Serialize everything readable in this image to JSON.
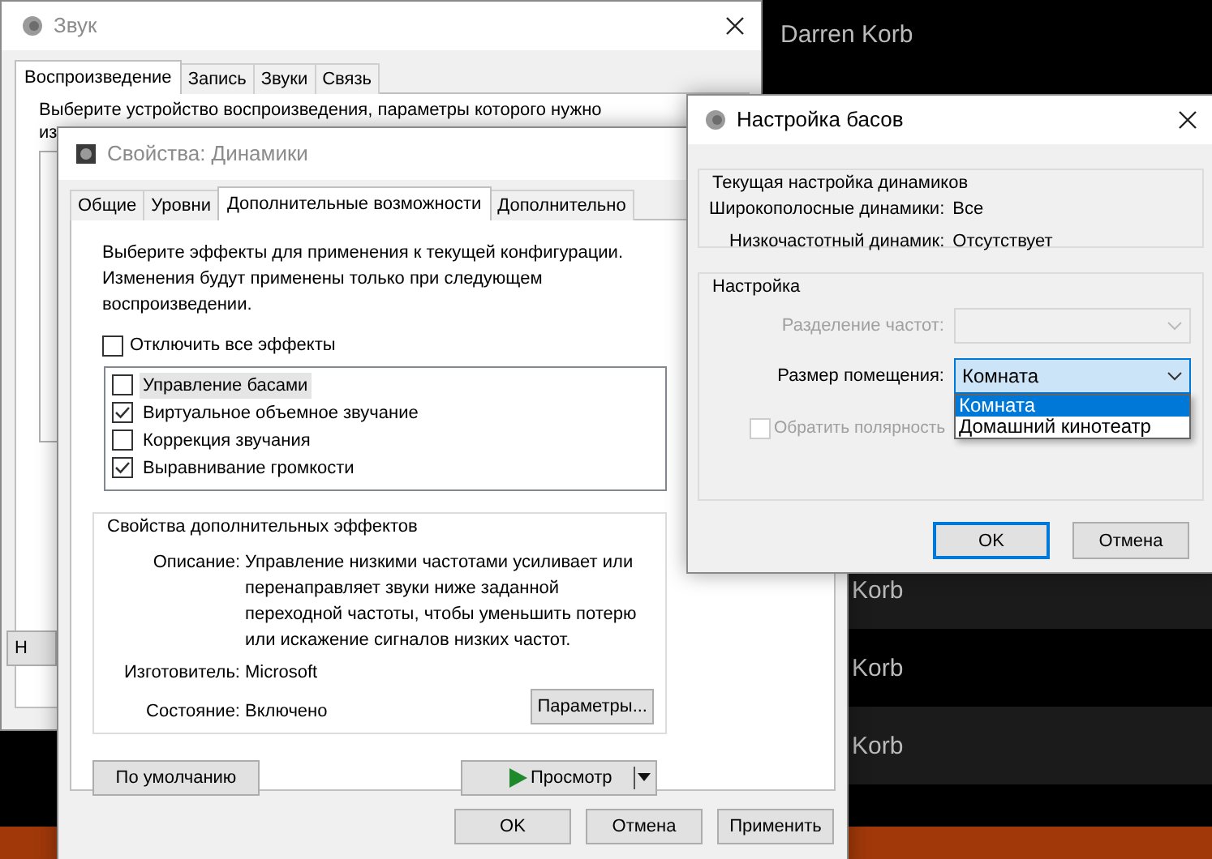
{
  "background_app": {
    "header": "Darren Korb",
    "rows": [
      "Korb",
      "Korb",
      "Korb"
    ]
  },
  "sound_window": {
    "title": "Звук",
    "active": false,
    "tabs": [
      {
        "label": "Воспроизведение",
        "selected": true
      },
      {
        "label": "Запись",
        "selected": false
      },
      {
        "label": "Звуки",
        "selected": false
      },
      {
        "label": "Связь",
        "selected": false
      }
    ],
    "instruction_lines": [
      "Выберите устройство воспроизведения, параметры которого нужно",
      "из"
    ],
    "button_fragment": "Н"
  },
  "properties_window": {
    "title": "Свойства: Динамики",
    "active": false,
    "tabs": [
      {
        "label": "Общие",
        "selected": false
      },
      {
        "label": "Уровни",
        "selected": false
      },
      {
        "label": "Дополнительные возможности",
        "selected": true
      },
      {
        "label": "Дополнительно",
        "selected": false
      }
    ],
    "intro": "Выберите эффекты для применения к текущей конфигурации. Изменения будут применены только при следующем воспроизведении.",
    "disable_all": {
      "label": "Отключить все эффекты",
      "checked": false
    },
    "effects": [
      {
        "label": "Управление басами",
        "checked": false,
        "selected": true
      },
      {
        "label": "Виртуальное объемное звучание",
        "checked": true,
        "selected": false
      },
      {
        "label": "Коррекция звучания",
        "checked": false,
        "selected": false
      },
      {
        "label": "Выравнивание громкости",
        "checked": true,
        "selected": false
      }
    ],
    "effect_properties": {
      "title": "Свойства дополнительных эффектов",
      "fields": [
        {
          "label": "Описание:",
          "value": "Управление низкими частотами усиливает или перенаправляет звуки ниже заданной переходной частоты, чтобы уменьшить потерю или искажение сигналов низких частот."
        },
        {
          "label": "Изготовитель:",
          "value": "Microsoft"
        },
        {
          "label": "Состояние:",
          "value": "Включено"
        }
      ],
      "settings_button": "Параметры..."
    },
    "default_button": "По умолчанию",
    "preview_button": "Просмотр",
    "buttons": [
      "OK",
      "Отмена",
      "Применить"
    ]
  },
  "bass_dialog": {
    "title": "Настройка басов",
    "active": true,
    "current": {
      "title": "Текущая настройка динамиков",
      "rows": [
        {
          "label": "Широкополосные динамики:",
          "value": "Все"
        },
        {
          "label": "Низкочастотный динамик:",
          "value": "Отсутствует"
        }
      ]
    },
    "settings": {
      "title": "Настройка",
      "crossover": {
        "label": "Разделение частот:",
        "disabled": true
      },
      "room_size": {
        "label": "Размер помещения:",
        "value": "Комната",
        "expanded": true,
        "options": [
          {
            "label": "Комната",
            "selected": true
          },
          {
            "label": "Домашний кинотеатр",
            "selected": false
          }
        ]
      },
      "invert_polarity": {
        "label": "Обратить полярность",
        "checked": false,
        "disabled": true
      }
    },
    "buttons": [
      {
        "label": "OK",
        "default": true
      },
      {
        "label": "Отмена",
        "default": false
      }
    ]
  }
}
